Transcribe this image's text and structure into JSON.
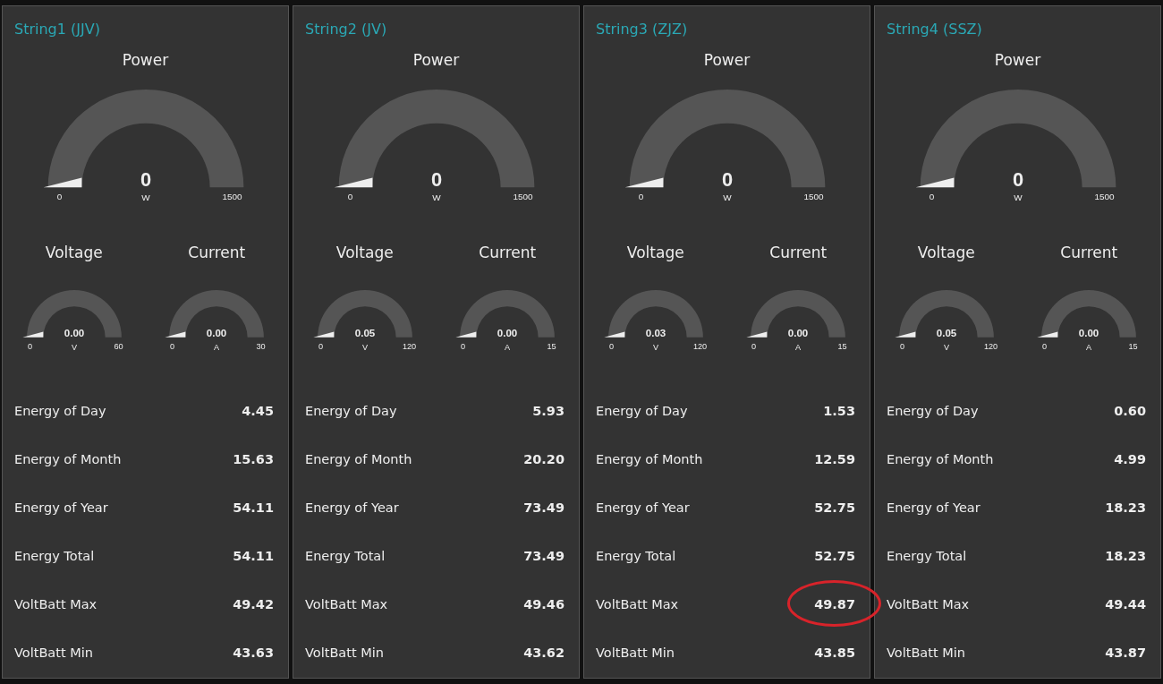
{
  "panels": [
    {
      "title": "String1 (JJV)",
      "power": {
        "label": "Power",
        "value": "0",
        "unit": "W",
        "min": "0",
        "max": "1500"
      },
      "small_gauges": [
        {
          "label": "Voltage",
          "value": "0.00",
          "unit": "V",
          "min": "0",
          "max": "60"
        },
        {
          "label": "Current",
          "value": "0.00",
          "unit": "A",
          "min": "0",
          "max": "30"
        }
      ],
      "rows": [
        {
          "label": "Energy of Day",
          "value": "4.45",
          "circled": false
        },
        {
          "label": "Energy of Month",
          "value": "15.63",
          "circled": false
        },
        {
          "label": "Energy of Year",
          "value": "54.11",
          "circled": false
        },
        {
          "label": "Energy Total",
          "value": "54.11",
          "circled": false
        },
        {
          "label": "VoltBatt Max",
          "value": "49.42",
          "circled": false
        },
        {
          "label": "VoltBatt Min",
          "value": "43.63",
          "circled": false
        }
      ]
    },
    {
      "title": "String2 (JV)",
      "power": {
        "label": "Power",
        "value": "0",
        "unit": "W",
        "min": "0",
        "max": "1500"
      },
      "small_gauges": [
        {
          "label": "Voltage",
          "value": "0.05",
          "unit": "V",
          "min": "0",
          "max": "120"
        },
        {
          "label": "Current",
          "value": "0.00",
          "unit": "A",
          "min": "0",
          "max": "15"
        }
      ],
      "rows": [
        {
          "label": "Energy of Day",
          "value": "5.93",
          "circled": false
        },
        {
          "label": "Energy of Month",
          "value": "20.20",
          "circled": false
        },
        {
          "label": "Energy of Year",
          "value": "73.49",
          "circled": false
        },
        {
          "label": "Energy Total",
          "value": "73.49",
          "circled": false
        },
        {
          "label": "VoltBatt Max",
          "value": "49.46",
          "circled": false
        },
        {
          "label": "VoltBatt Min",
          "value": "43.62",
          "circled": false
        }
      ]
    },
    {
      "title": "String3 (ZJZ)",
      "power": {
        "label": "Power",
        "value": "0",
        "unit": "W",
        "min": "0",
        "max": "1500"
      },
      "small_gauges": [
        {
          "label": "Voltage",
          "value": "0.03",
          "unit": "V",
          "min": "0",
          "max": "120"
        },
        {
          "label": "Current",
          "value": "0.00",
          "unit": "A",
          "min": "0",
          "max": "15"
        }
      ],
      "rows": [
        {
          "label": "Energy of Day",
          "value": "1.53",
          "circled": false
        },
        {
          "label": "Energy of Month",
          "value": "12.59",
          "circled": false
        },
        {
          "label": "Energy of Year",
          "value": "52.75",
          "circled": false
        },
        {
          "label": "Energy Total",
          "value": "52.75",
          "circled": false
        },
        {
          "label": "VoltBatt Max",
          "value": "49.87",
          "circled": true
        },
        {
          "label": "VoltBatt Min",
          "value": "43.85",
          "circled": false
        }
      ]
    },
    {
      "title": "String4 (SSZ)",
      "power": {
        "label": "Power",
        "value": "0",
        "unit": "W",
        "min": "0",
        "max": "1500"
      },
      "small_gauges": [
        {
          "label": "Voltage",
          "value": "0.05",
          "unit": "V",
          "min": "0",
          "max": "120"
        },
        {
          "label": "Current",
          "value": "0.00",
          "unit": "A",
          "min": "0",
          "max": "15"
        }
      ],
      "rows": [
        {
          "label": "Energy of Day",
          "value": "0.60",
          "circled": false
        },
        {
          "label": "Energy of Month",
          "value": "4.99",
          "circled": false
        },
        {
          "label": "Energy of Year",
          "value": "18.23",
          "circled": false
        },
        {
          "label": "Energy Total",
          "value": "18.23",
          "circled": false
        },
        {
          "label": "VoltBatt Max",
          "value": "49.44",
          "circled": false
        },
        {
          "label": "VoltBatt Min",
          "value": "43.87",
          "circled": false
        }
      ]
    }
  ]
}
